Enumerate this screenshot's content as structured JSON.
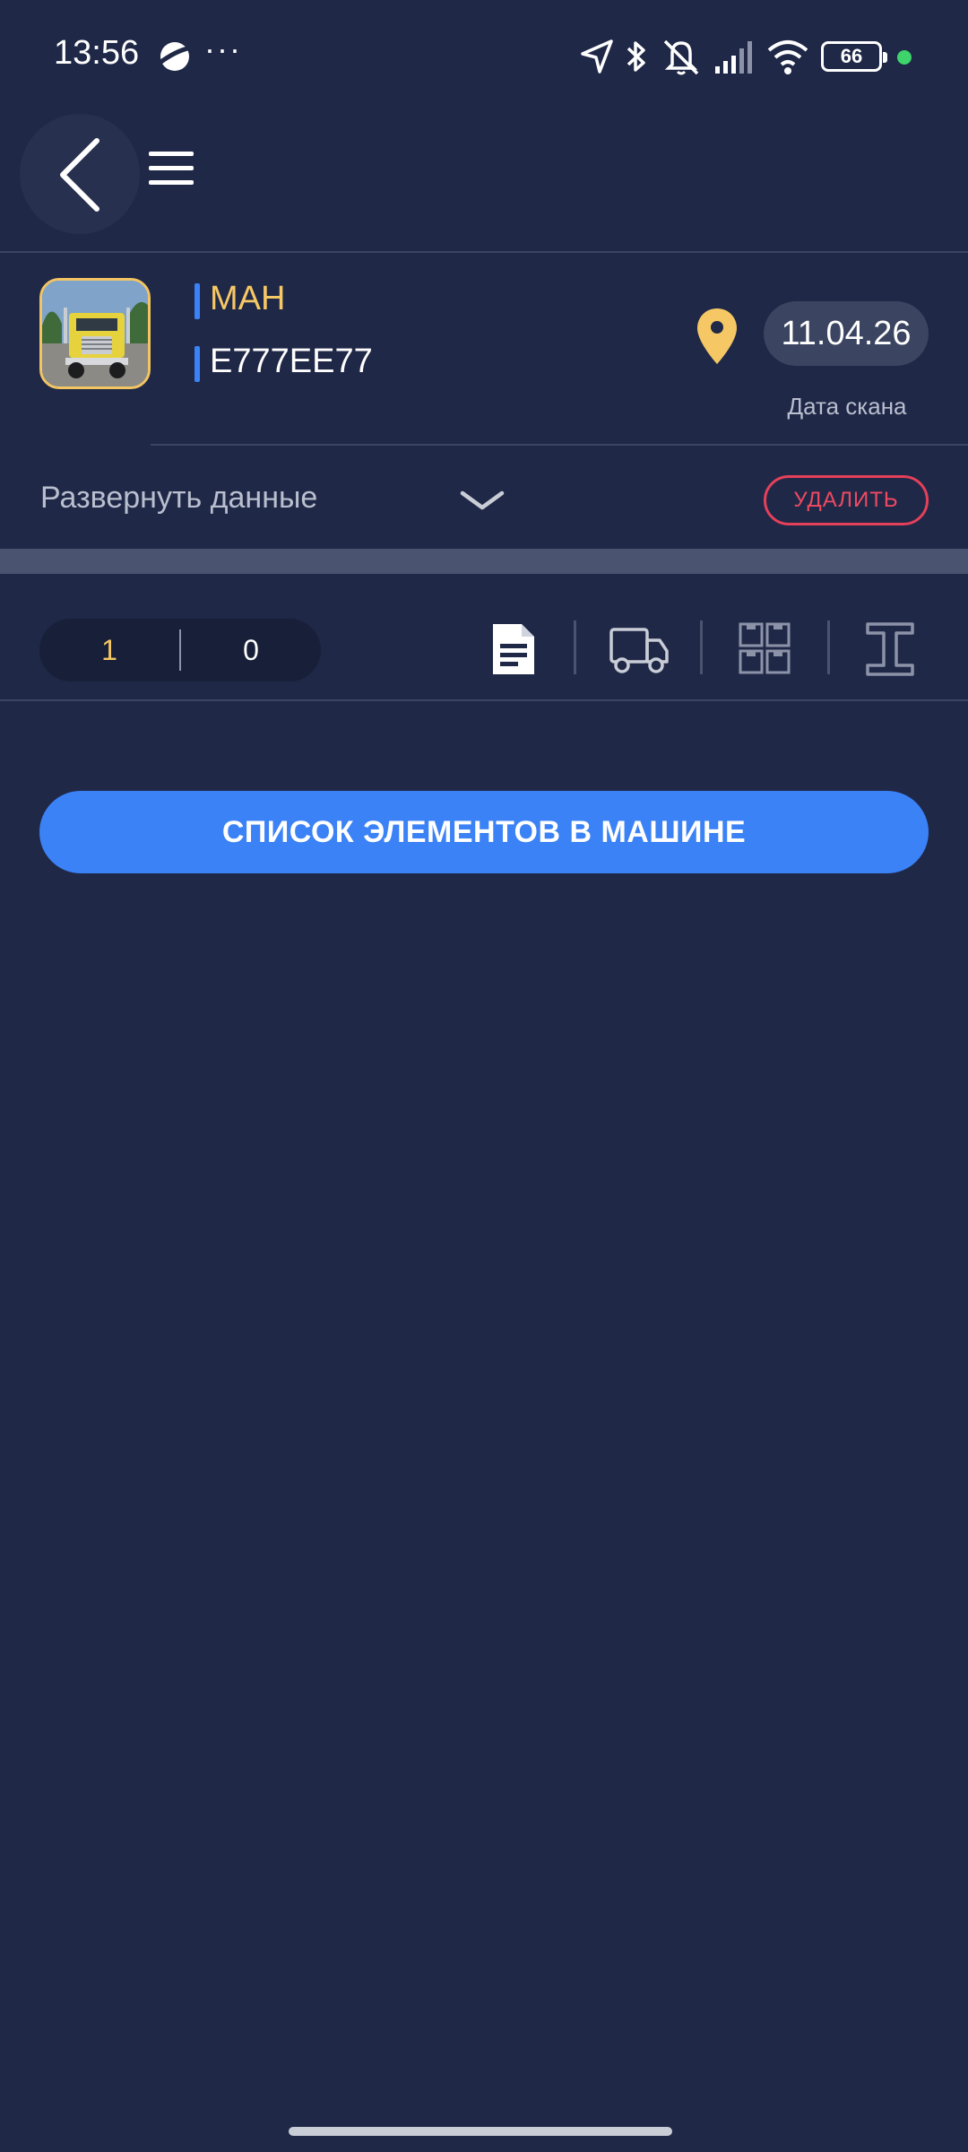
{
  "status_bar": {
    "time": "13:56",
    "more": "···",
    "battery": "66",
    "icons": [
      "planet-icon",
      "location-arrow-icon",
      "bluetooth-icon",
      "bell-off-icon",
      "signal-icon",
      "wifi-icon",
      "battery-icon",
      "privacy-dot-icon"
    ]
  },
  "header": {
    "icons": [
      "back-chevron-icon",
      "hamburger-menu-icon"
    ]
  },
  "vehicle": {
    "name": "МАН",
    "plate": "Е777ЕЕ77",
    "scan_date": "11.04.26",
    "scan_date_label": "Дата скана",
    "expand_label": "Развернуть данные",
    "delete_label": "УДАЛИТЬ",
    "thumbnail": "truck-photo"
  },
  "toolbar": {
    "count_primary": "1",
    "count_secondary": "0",
    "tools": [
      "document-icon",
      "truck-icon",
      "grid-boxes-icon",
      "i-beam-icon"
    ]
  },
  "main": {
    "primary_button_label": "СПИСОК ЭЛЕМЕНТОВ В МАШИНЕ"
  },
  "colors": {
    "background": "#1f2847",
    "accent_blue": "#3b82f6",
    "accent_yellow": "#f6c765",
    "danger": "#e4405a"
  }
}
